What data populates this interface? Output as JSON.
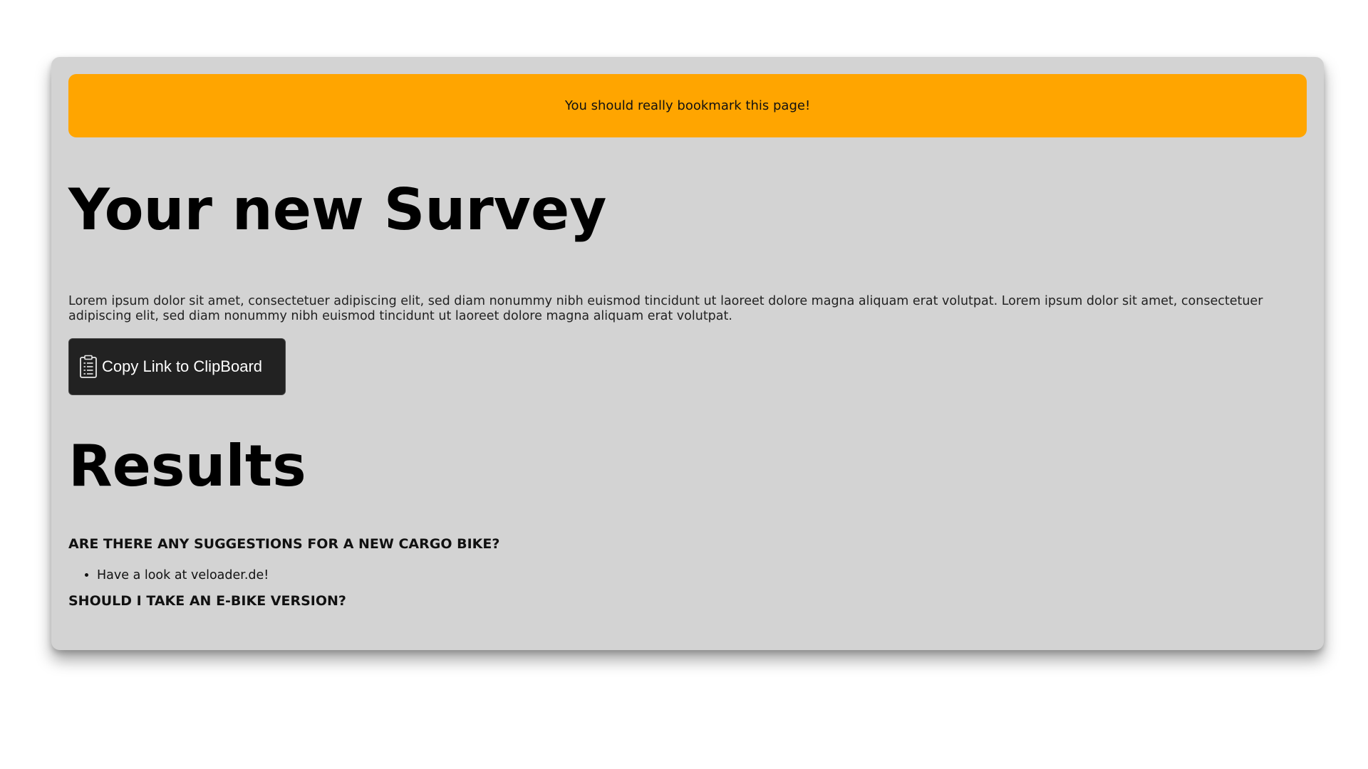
{
  "banner": {
    "text": "You should really bookmark this page!",
    "color": "#ffa500"
  },
  "survey": {
    "title": "Your new Survey",
    "description": "Lorem ipsum dolor sit amet, consectetuer adipiscing elit, sed diam nonummy nibh euismod tincidunt ut laoreet dolore magna aliquam erat volutpat. Lorem ipsum dolor sit amet, consectetuer adipiscing elit, sed diam nonummy nibh euismod tincidunt ut laoreet dolore magna aliquam erat volutpat.",
    "copy_button": {
      "label": "Copy Link to ClipBoard",
      "icon": "clipboard-icon"
    }
  },
  "results": {
    "title": "Results",
    "questions": [
      {
        "question": "ARE THERE ANY SUGGESTIONS FOR A NEW CARGO BIKE?",
        "answers": [
          "Have a look at veloader.de!"
        ]
      },
      {
        "question": "SHOULD I TAKE AN E-BIKE VERSION?",
        "answers": []
      }
    ]
  }
}
